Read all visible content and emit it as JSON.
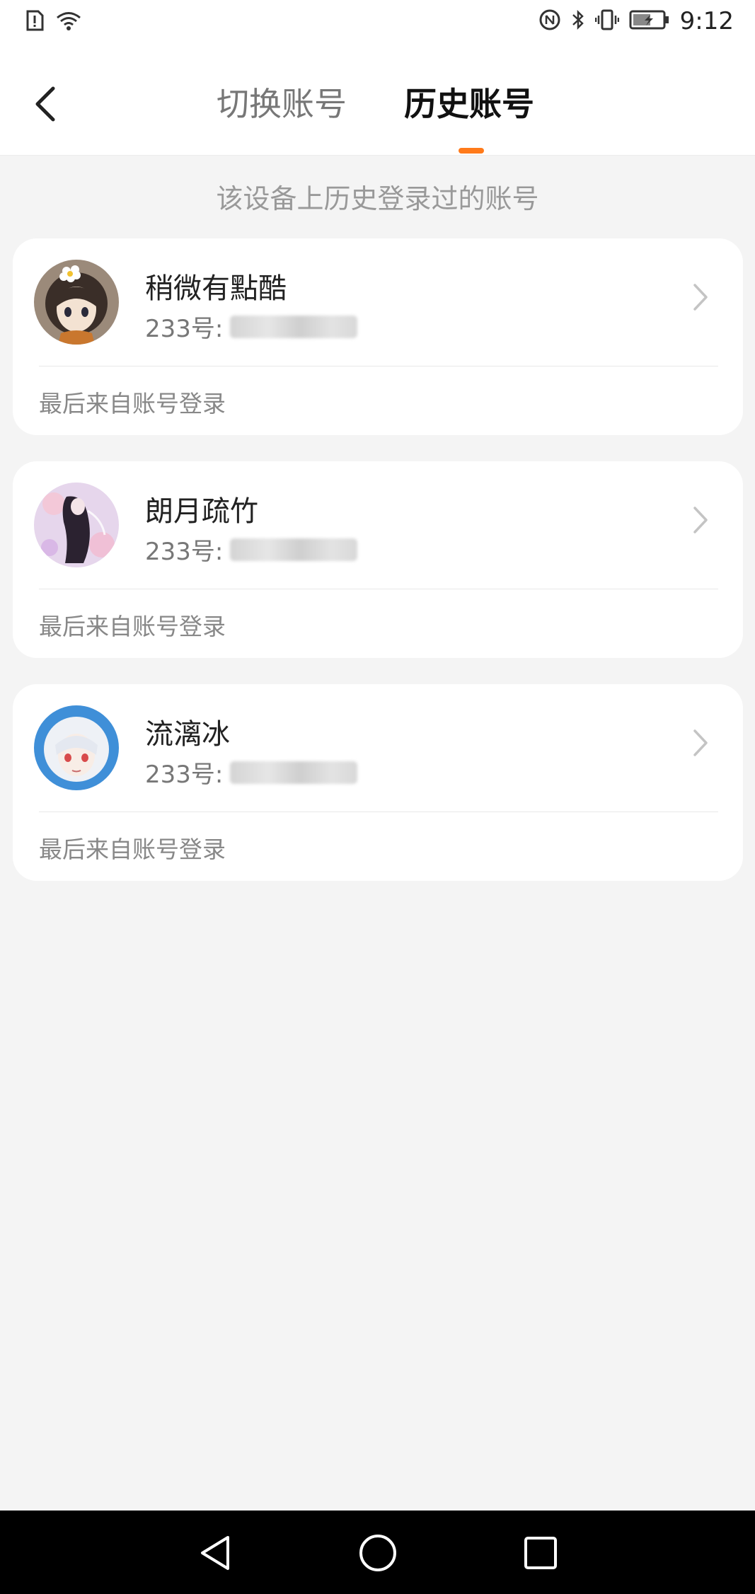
{
  "status_bar": {
    "time": "9:12",
    "icons": [
      "alert-icon",
      "wifi-icon",
      "nfc-icon",
      "bluetooth-icon",
      "vibrate-icon",
      "battery-icon"
    ]
  },
  "header": {
    "back_icon": "chevron-left-icon",
    "tabs": [
      {
        "label": "切换账号",
        "active": false
      },
      {
        "label": "历史账号",
        "active": true
      }
    ],
    "accent_color": "#ff7a1a"
  },
  "hint": "该设备上历史登录过的账号",
  "accounts": [
    {
      "name": "稍微有點酷",
      "id_label": "233号:",
      "last_login": "最后来自账号登录"
    },
    {
      "name": "朗月疏竹",
      "id_label": "233号:",
      "last_login": "最后来自账号登录"
    },
    {
      "name": "流漓冰",
      "id_label": "233号:",
      "last_login": "最后来自账号登录"
    }
  ],
  "nav_bar": {
    "icons": [
      "back-triangle-icon",
      "home-circle-icon",
      "recents-square-icon"
    ]
  }
}
